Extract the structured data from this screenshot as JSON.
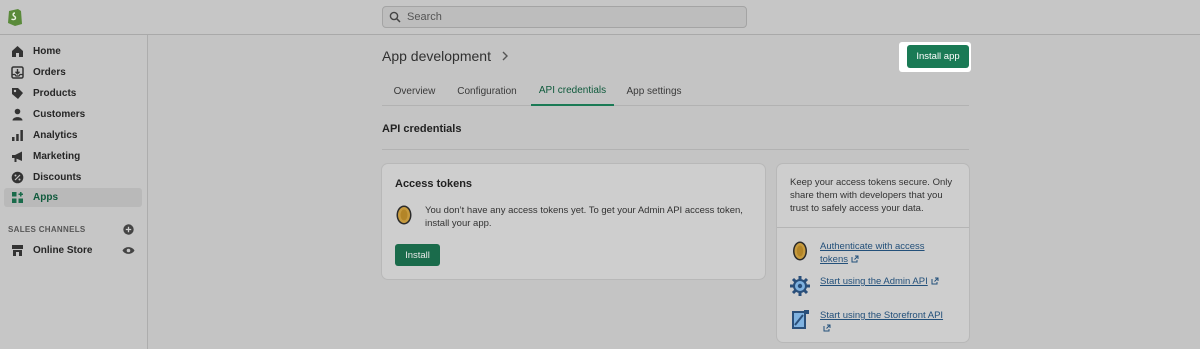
{
  "search": {
    "placeholder": "Search"
  },
  "sidebar": {
    "items": [
      {
        "label": "Home",
        "icon": "home-icon"
      },
      {
        "label": "Orders",
        "icon": "orders-icon"
      },
      {
        "label": "Products",
        "icon": "tag-icon"
      },
      {
        "label": "Customers",
        "icon": "person-icon"
      },
      {
        "label": "Analytics",
        "icon": "bar-chart-icon"
      },
      {
        "label": "Marketing",
        "icon": "megaphone-icon"
      },
      {
        "label": "Discounts",
        "icon": "discount-icon"
      },
      {
        "label": "Apps",
        "icon": "apps-icon",
        "active": true
      }
    ],
    "section_label": "SALES CHANNELS",
    "channels": [
      {
        "label": "Online Store",
        "icon": "store-icon"
      }
    ]
  },
  "header": {
    "title": "App development",
    "install_app_label": "Install app"
  },
  "tabs": [
    {
      "label": "Overview"
    },
    {
      "label": "Configuration"
    },
    {
      "label": "API credentials",
      "active": true
    },
    {
      "label": "App settings"
    }
  ],
  "main": {
    "section_title": "API credentials",
    "access_tokens": {
      "title": "Access tokens",
      "text": "You don’t have any access tokens yet. To get your Admin API access token, install your app.",
      "install_label": "Install"
    },
    "help": {
      "text": "Keep your access tokens secure. Only share them with developers that you trust to safely access your data.",
      "links": [
        {
          "label": "Authenticate with access tokens",
          "icon": "token-icon"
        },
        {
          "label": "Start using the Admin API",
          "icon": "gear-icon"
        },
        {
          "label": "Start using the Storefront API",
          "icon": "storefront-icon"
        }
      ]
    }
  },
  "colors": {
    "accent": "#1a7a55",
    "link": "#23507a"
  }
}
